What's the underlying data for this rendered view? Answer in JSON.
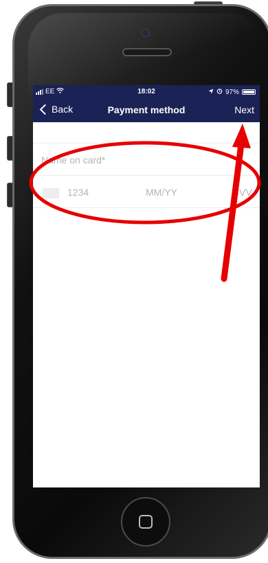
{
  "status_bar": {
    "carrier": "EE",
    "time": "18:02",
    "battery": "97%",
    "battery_level": 0.97,
    "icons": [
      "signal-icon",
      "wifi-icon",
      "location-icon",
      "alarm-icon",
      "battery-icon"
    ]
  },
  "nav": {
    "back_label": "Back",
    "title": "Payment method",
    "next_label": "Next"
  },
  "form": {
    "name_placeholder": "Name on card*",
    "card_number_placeholder": "1234",
    "expiry_placeholder": "MM/YY",
    "cvv_placeholder": "CVV"
  },
  "colors": {
    "nav_background": "#1b2255",
    "annotation": "#e60000",
    "placeholder_text": "#b4b4b4"
  },
  "annotations": [
    "red-ellipse-highlight",
    "red-arrow-to-next"
  ]
}
